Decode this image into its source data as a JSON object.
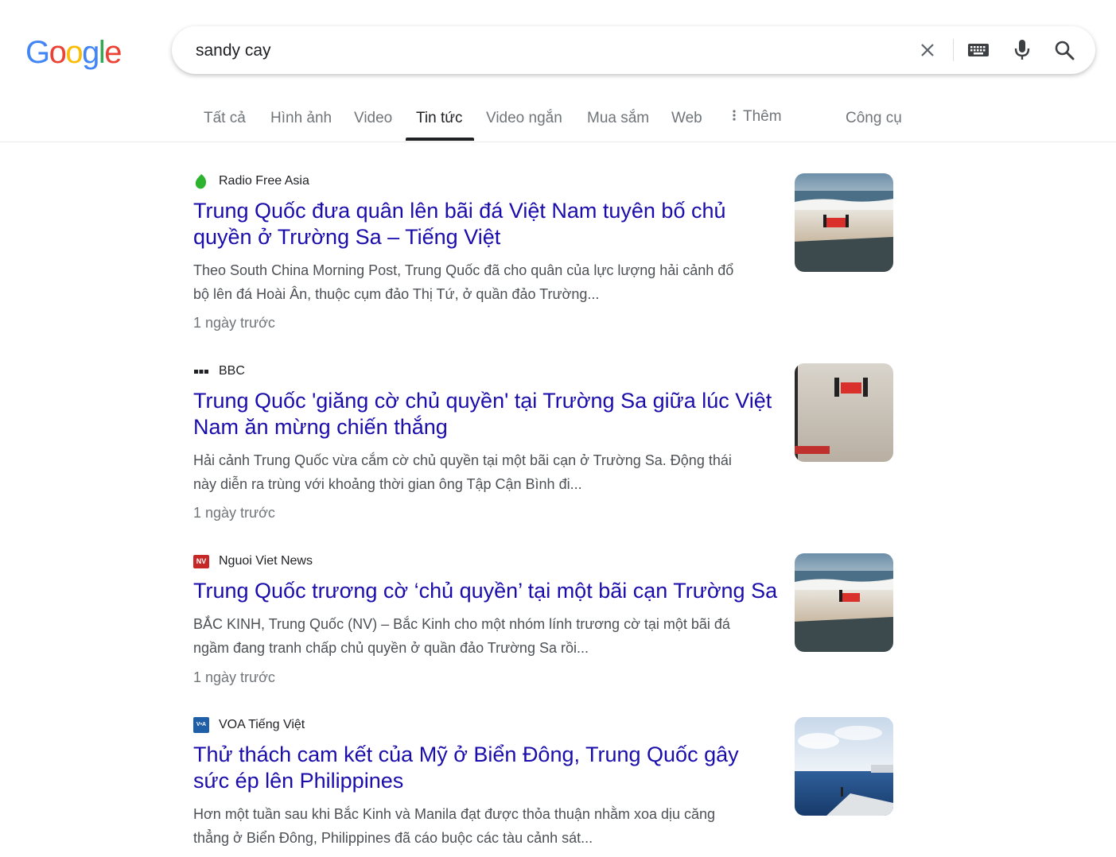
{
  "logo": {
    "letters": [
      "G",
      "o",
      "o",
      "g",
      "l",
      "e"
    ]
  },
  "search": {
    "query": "sandy cay",
    "placeholder": ""
  },
  "icons": {
    "clear": "close-icon",
    "keyboard": "keyboard-icon",
    "voice": "microphone-icon",
    "search": "search-icon"
  },
  "tabs": [
    {
      "label": "Tất cả"
    },
    {
      "label": "Hình ảnh"
    },
    {
      "label": "Video"
    },
    {
      "label": "Tin tức"
    },
    {
      "label": "Video ngắn"
    },
    {
      "label": "Mua sắm"
    },
    {
      "label": "Web"
    },
    {
      "label": "Thêm"
    },
    {
      "label": "Công cụ"
    }
  ],
  "active_tab": "Tin tức",
  "results": [
    {
      "source": "Radio Free Asia",
      "title_line1": "Trung Quốc đưa quân lên bãi đá Việt Nam tuyên bố chủ",
      "title_line2": "quyền ở Trường Sa – Tiếng Việt",
      "snippet_line1": "Theo South China Morning Post, Trung Quốc đã cho quân của lực lượng hải cảnh đổ",
      "snippet_line2": "bộ lên đá Hoài Ân, thuộc cụm đảo Thị Tứ, ở quần đảo Trường...",
      "time": "1 ngày trước"
    },
    {
      "source": "BBC",
      "title_line1": "Trung Quốc 'giăng cờ chủ quyền' tại Trường Sa giữa lúc Việt",
      "title_line2": "Nam ăn mừng chiến thắng",
      "snippet_line1": "Hải cảnh Trung Quốc vừa cắm cờ chủ quyền tại một bãi cạn ở Trường Sa. Động thái",
      "snippet_line2": "này diễn ra trùng với khoảng thời gian ông Tập Cận Bình đi...",
      "time": "1 ngày trước"
    },
    {
      "source": "Nguoi Viet News",
      "title_line1": "Trung Quốc trương cờ ‘chủ quyền’ tại một bãi cạn Trường Sa",
      "snippet_line1": "BẮC KINH, Trung Quốc (NV) – Bắc Kinh cho một nhóm lính trương cờ tại một bãi đá",
      "snippet_line2": "ngầm đang tranh chấp chủ quyền ở quần đảo Trường Sa rồi...",
      "time": "1 ngày trước"
    },
    {
      "source": "VOA Tiếng Việt",
      "title_line1": "Thử thách cam kết của Mỹ ở Biển Đông, Trung Quốc gây",
      "title_line2": "sức ép lên Philippines",
      "snippet_line1": "Hơn một tuần sau khi Bắc Kinh và Manila đạt được thỏa thuận nhằm xoa dịu căng",
      "snippet_line2": "thẳng ở Biển Đông, Philippines đã cáo buộc các tàu cảnh sát..."
    }
  ],
  "favicons": {
    "nv": "NV",
    "voa": "V•A"
  },
  "colors": {
    "link": "#1a0dab",
    "snippet": "#4d5156",
    "meta": "#70757a"
  }
}
